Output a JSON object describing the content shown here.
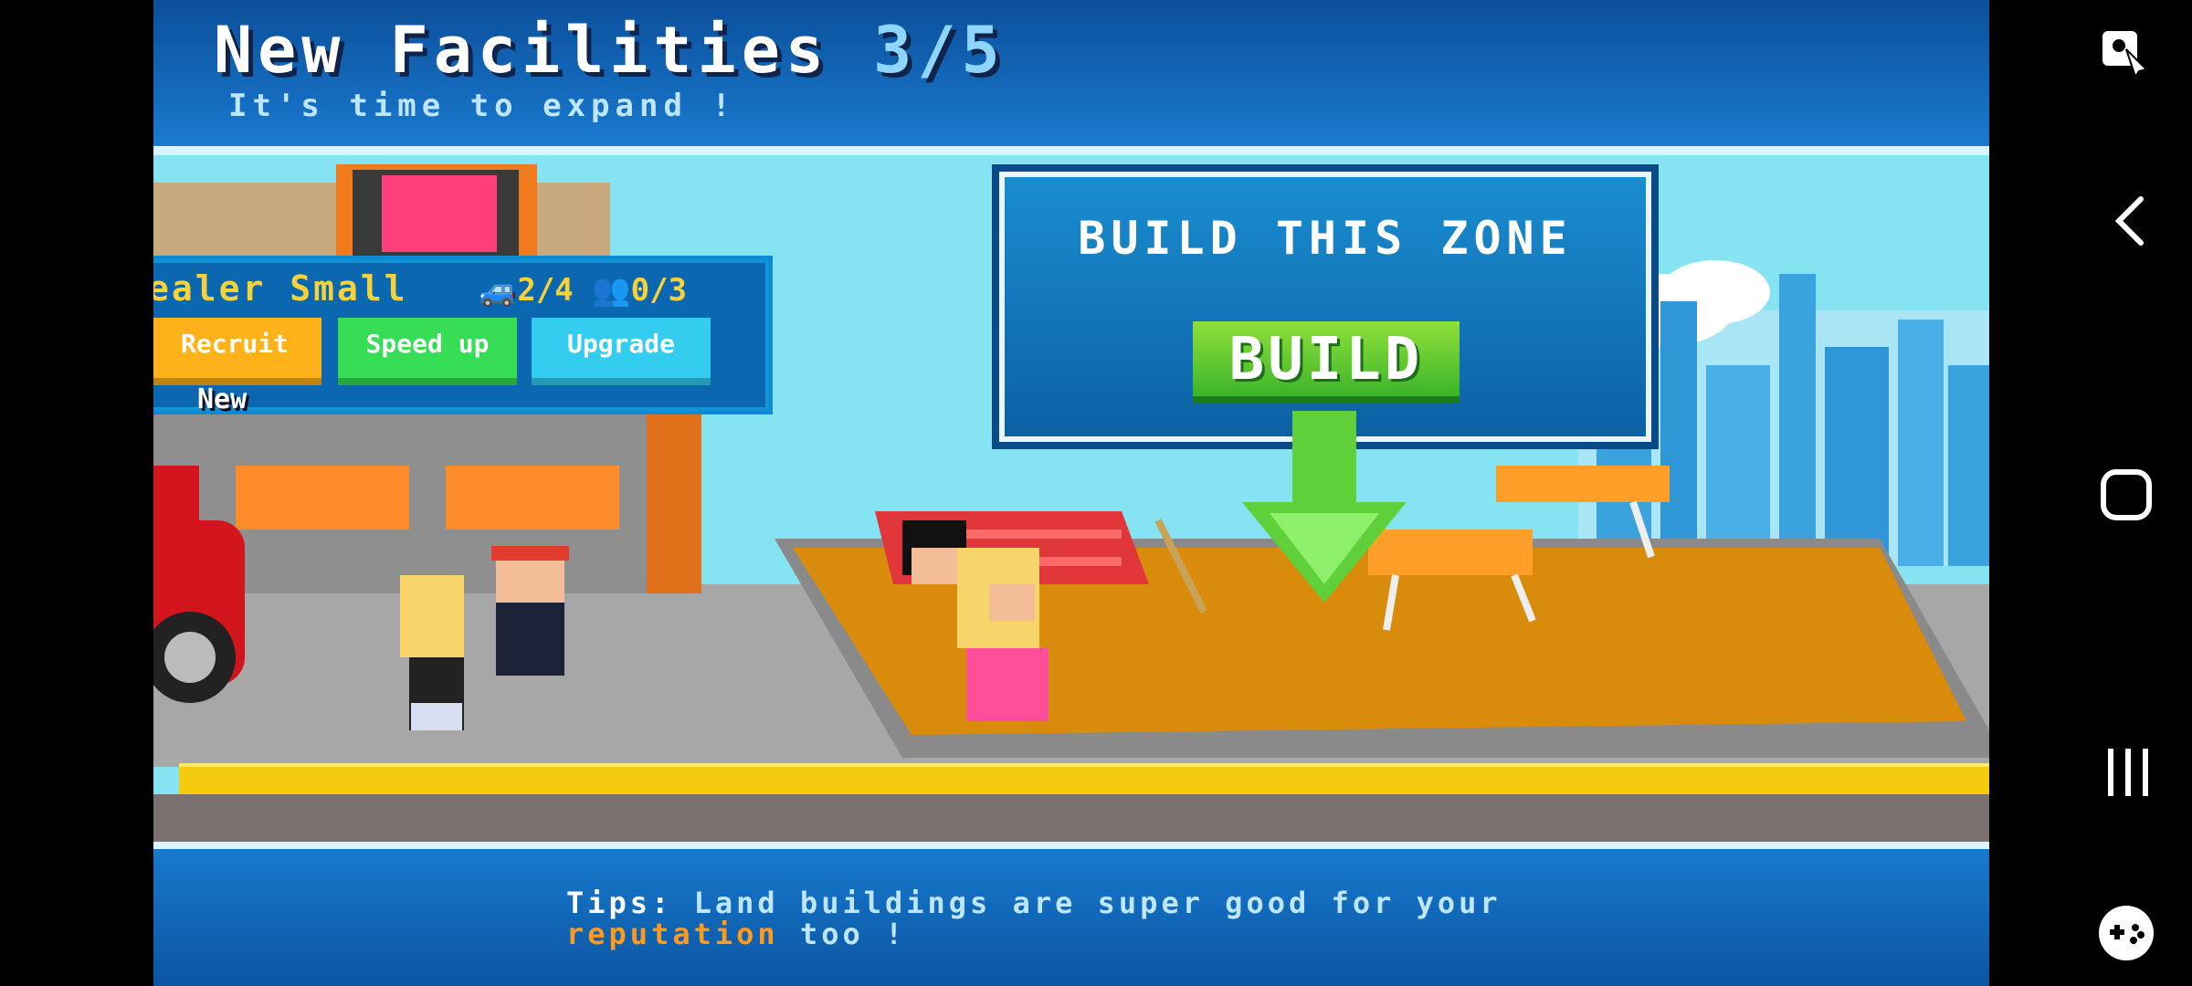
{
  "header": {
    "title": "New Facilities",
    "count": "3/5",
    "subtitle": "It's time to expand !"
  },
  "facility_panel": {
    "name": "ealer  Small",
    "cars": "2/4",
    "staff": "0/3",
    "buttons": {
      "recruit": "Recruit",
      "speed_up": "Speed up",
      "upgrade": "Upgrade"
    },
    "new_label": "New"
  },
  "build_sign": {
    "title": "BUILD THIS ZONE",
    "button": "BUILD"
  },
  "tips": {
    "label": "Tips:",
    "text1": " Land buildings are super good for your",
    "highlight": "reputation",
    "text2": " too !"
  },
  "nav": {
    "screenshot_icon": "screenshot-tool-icon",
    "back_icon": "back-icon",
    "home_icon": "home-icon",
    "recents_icon": "recents-icon",
    "game_icon": "game-launcher-icon"
  },
  "colors": {
    "accent_blue": "#0b67b0",
    "build_green": "#3cb42a",
    "highlight_orange": "#ff9a1c",
    "title_count": "#8ed6ff"
  }
}
